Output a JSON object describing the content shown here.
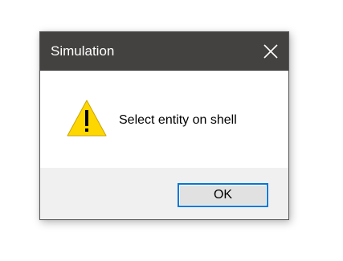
{
  "dialog": {
    "title": "Simulation",
    "message": "Select entity on shell",
    "ok_label": "OK",
    "icons": {
      "close": "close-icon",
      "warning": "warning-icon"
    },
    "colors": {
      "titlebar": "#444240",
      "title_text": "#ffffff",
      "footer": "#f0f0f0",
      "button_bg": "#e1e1e1",
      "button_focus_border": "#0078d7",
      "warning_fill": "#ffd700"
    }
  }
}
